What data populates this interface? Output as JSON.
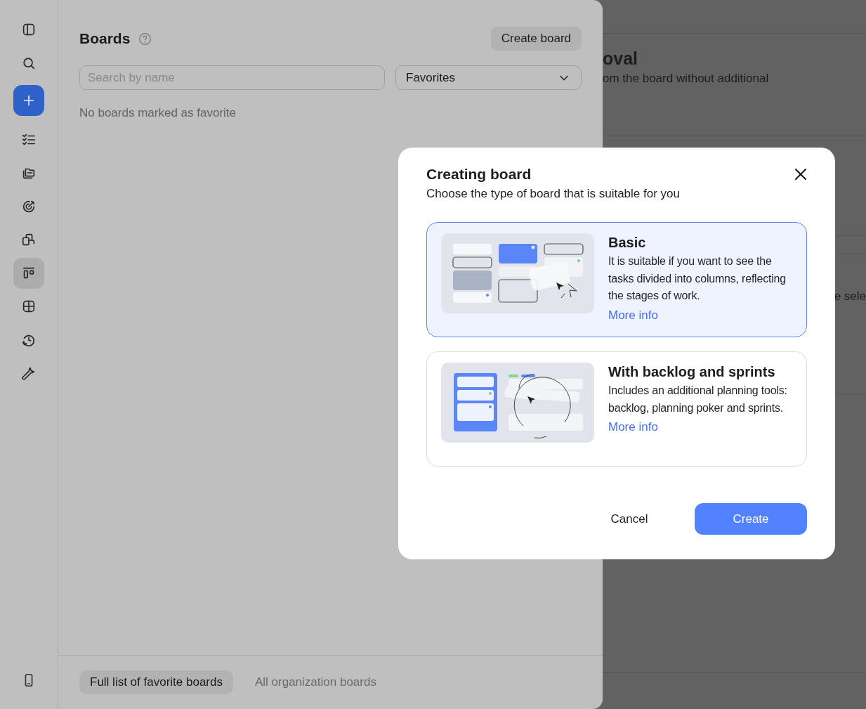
{
  "background": {
    "heading": "oval",
    "text": "om the board without additional",
    "side_text": "e sele"
  },
  "sidebar": {
    "items": [
      {
        "kind": "plain",
        "selected": false
      },
      {
        "kind": "plain",
        "selected": false
      },
      {
        "kind": "primary",
        "selected": false
      },
      {
        "kind": "plain",
        "selected": false
      },
      {
        "kind": "plain",
        "selected": false
      },
      {
        "kind": "plain",
        "selected": false
      },
      {
        "kind": "plain",
        "selected": false
      },
      {
        "kind": "plain",
        "selected": true
      },
      {
        "kind": "plain",
        "selected": false
      },
      {
        "kind": "plain",
        "selected": false
      },
      {
        "kind": "plain",
        "selected": false
      }
    ]
  },
  "panel": {
    "title": "Boards",
    "create_button": "Create board",
    "search": {
      "placeholder": "Search by name"
    },
    "filter": {
      "value": "Favorites"
    },
    "empty_message": "No boards marked as favorite",
    "footer_tabs": [
      {
        "label": "Full list of favorite boards",
        "selected": true
      },
      {
        "label": "All organization boards",
        "selected": false
      }
    ]
  },
  "dialog": {
    "title": "Creating board",
    "subtitle": "Choose the type of board that is suitable for you",
    "options": [
      {
        "kind": "columns",
        "title": "Basic",
        "description": "It is suitable if you want to see the tasks divided into columns, reflecting the stages of work.",
        "link": "More info",
        "selected": true
      },
      {
        "kind": "backlog",
        "title": "With backlog and sprints",
        "description": "Includes an additional planning tools: backlog, planning poker and sprints.",
        "link": "More info",
        "selected": false
      }
    ],
    "buttons": {
      "cancel": "Cancel",
      "confirm": "Create"
    }
  }
}
